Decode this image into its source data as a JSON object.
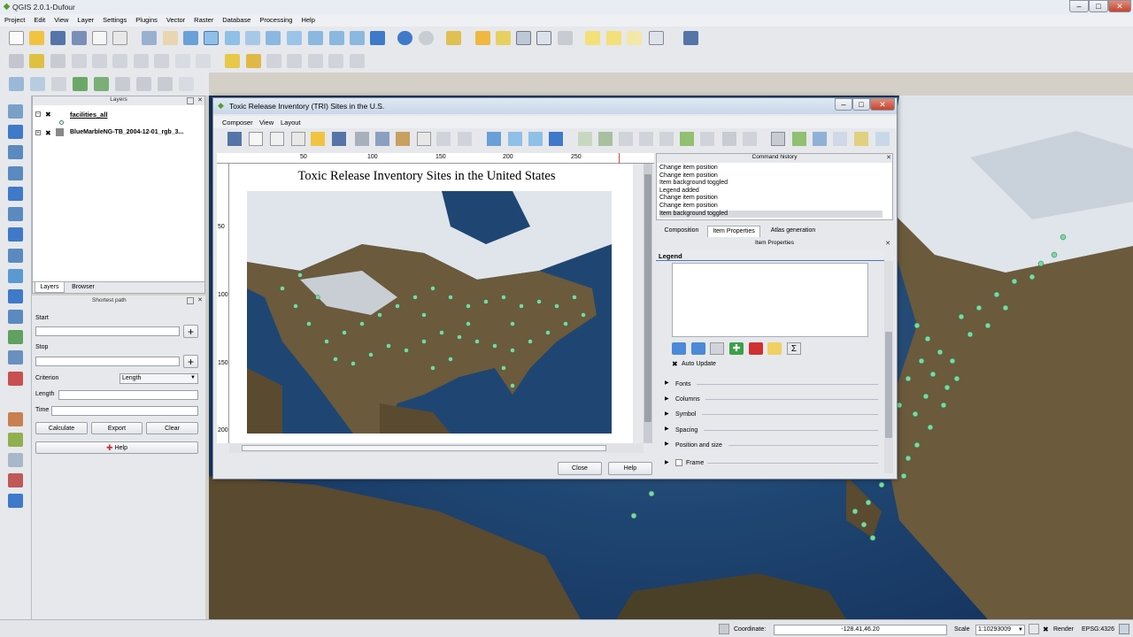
{
  "window": {
    "title": "QGIS 2.0.1-Dufour",
    "min": "–",
    "max": "□",
    "close": "✕"
  },
  "menu": [
    "Project",
    "Edit",
    "View",
    "Layer",
    "Settings",
    "Plugins",
    "Vector",
    "Raster",
    "Database",
    "Processing",
    "Help"
  ],
  "layers_panel": {
    "title": "Layers",
    "items": [
      {
        "name": "facilities_all",
        "checked": "✖"
      },
      {
        "name": "BlueMarbleNG-TB_2004-12-01_rgb_3...",
        "checked": "✖"
      }
    ],
    "tabs": [
      "Layers",
      "Browser"
    ]
  },
  "shortest_path": {
    "title": "Shortest path",
    "start_label": "Start",
    "stop_label": "Stop",
    "criterion_label": "Criterion",
    "criterion_value": "Length",
    "length_label": "Length",
    "time_label": "Time",
    "calculate": "Calculate",
    "export": "Export",
    "clear": "Clear",
    "help": "Help"
  },
  "composer": {
    "title": "Toxic Release Inventory (TRI) Sites in the U.S.",
    "menu": [
      "Composer",
      "View",
      "Layout"
    ],
    "map_title": "Toxic Release Inventory Sites in the United States",
    "ruler_top": [
      "50",
      "100",
      "150",
      "200",
      "250"
    ],
    "ruler_left": [
      "50",
      "100",
      "150",
      "200"
    ],
    "command_history": {
      "title": "Command history",
      "items": [
        "Change item position",
        "Change item position",
        "Item background toggled",
        "Legend added",
        "Change item position",
        "Change item position",
        "Item background toggled"
      ]
    },
    "tabs": [
      "Composition",
      "Item Properties",
      "Atlas generation"
    ],
    "item_properties_title": "Item Properties",
    "legend_label": "Legend",
    "auto_update": "Auto Update",
    "auto_update_check": "✖",
    "sections": [
      "Fonts",
      "Columns",
      "Symbol",
      "Spacing",
      "Position and size",
      "Frame"
    ],
    "close": "Close",
    "help": "Help"
  },
  "statusbar": {
    "coordinate_label": "Coordinate:",
    "coordinate_value": "-128.41,46.20",
    "scale_label": "Scale",
    "scale_value": "1:10293009",
    "render": "Render",
    "epsg": "EPSG:4326"
  },
  "colors": {
    "accent": "#3f79c9",
    "points": "#7ad9a0",
    "ocean": "#1f4672",
    "land": "#6b5a3c",
    "snow": "#e8ecef"
  }
}
